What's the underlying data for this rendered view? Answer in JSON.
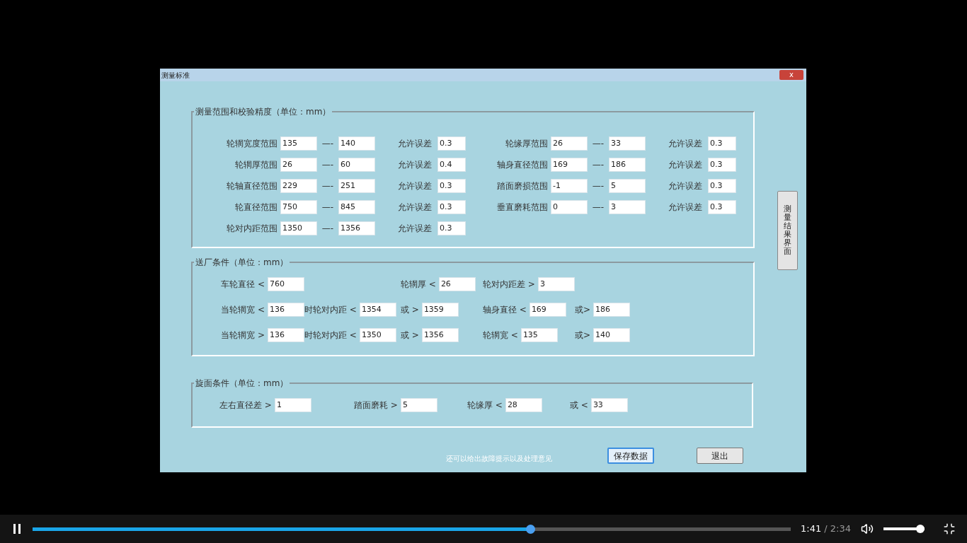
{
  "window": {
    "title": "测量标准",
    "close": "x"
  },
  "range_section": {
    "title": "测量范围和校验精度（单位：mm）",
    "columns": [
      [
        {
          "label": "轮辋宽度范围",
          "min": "135",
          "separator": "—-",
          "max": "140",
          "tolerance_label": "允许误差",
          "tolerance": "0.3"
        },
        {
          "label": "轮辋厚范围",
          "min": "26",
          "separator": "—-",
          "max": "60",
          "tolerance_label": "允许误差",
          "tolerance": "0.4"
        },
        {
          "label": "轮轴直径范围",
          "min": "229",
          "separator": "—-",
          "max": "251",
          "tolerance_label": "允许误差",
          "tolerance": "0.3"
        },
        {
          "label": "轮直径范围",
          "min": "750",
          "separator": "—-",
          "max": "845",
          "tolerance_label": "允许误差",
          "tolerance": "0.3"
        },
        {
          "label": "轮对内距范围",
          "min": "1350",
          "separator": "—-",
          "max": "1356",
          "tolerance_label": "允许误差",
          "tolerance": "0.3"
        }
      ],
      [
        {
          "label": "轮缘厚范围",
          "min": "26",
          "separator": "—-",
          "max": "33",
          "tolerance_label": "允许误差",
          "tolerance": "0.3"
        },
        {
          "label": "轴身直径范围",
          "min": "169",
          "separator": "—-",
          "max": "186",
          "tolerance_label": "允许误差",
          "tolerance": "0.3"
        },
        {
          "label": "踏面磨损范围",
          "min": "-1",
          "separator": "—-",
          "max": "5",
          "tolerance_label": "允许误差",
          "tolerance": "0.3"
        },
        {
          "label": "垂直磨耗范围",
          "min": "0",
          "separator": "—-",
          "max": "3",
          "tolerance_label": "允许误差",
          "tolerance": "0.3"
        }
      ]
    ]
  },
  "factory_section": {
    "title": "送厂条件（单位：mm）",
    "rows": [
      [
        {
          "label": "车轮直径 <",
          "value": "760"
        },
        "",
        {
          "label": "轮辋厚 <",
          "value": "26"
        },
        {
          "label": "轮对内距差 >",
          "value": "3"
        }
      ],
      [
        {
          "label": "当轮辋宽 <",
          "value": "136"
        },
        {
          "label": "时轮对内距 <",
          "value": "1354"
        },
        {
          "label": "或 >",
          "value": "1359"
        },
        {
          "label": "轴身直径 <",
          "value": "169"
        },
        {
          "label": "或>",
          "value": "186"
        }
      ],
      [
        {
          "label": "当轮辋宽 >",
          "value": "136"
        },
        {
          "label": "时轮对内距 <",
          "value": "1350"
        },
        {
          "label": "或 >",
          "value": "1356"
        },
        {
          "label": "轮辋宽 <",
          "value": "135"
        },
        {
          "label": "或>",
          "value": "140"
        }
      ]
    ]
  },
  "turning_section": {
    "title": "旋面条件（单位：mm）",
    "items": [
      {
        "label": "左右直径差 >",
        "value": "1"
      },
      {
        "label": "踏面磨耗 >",
        "value": "5"
      },
      {
        "label": "轮缘厚 <",
        "value": "28"
      },
      {
        "label": "或 <",
        "value": "33"
      }
    ]
  },
  "side_button": "测量结果界面",
  "note": "还可以给出故障提示以及处理意见",
  "buttons": [
    {
      "label": "保存数据",
      "focused": true
    },
    {
      "label": "退出",
      "focused": false
    }
  ],
  "player": {
    "playing": true,
    "progress": {
      "level": 0.656
    },
    "current_time": "1:41",
    "total_time": "/ 2:34",
    "volume": {
      "level": 1.0
    }
  }
}
